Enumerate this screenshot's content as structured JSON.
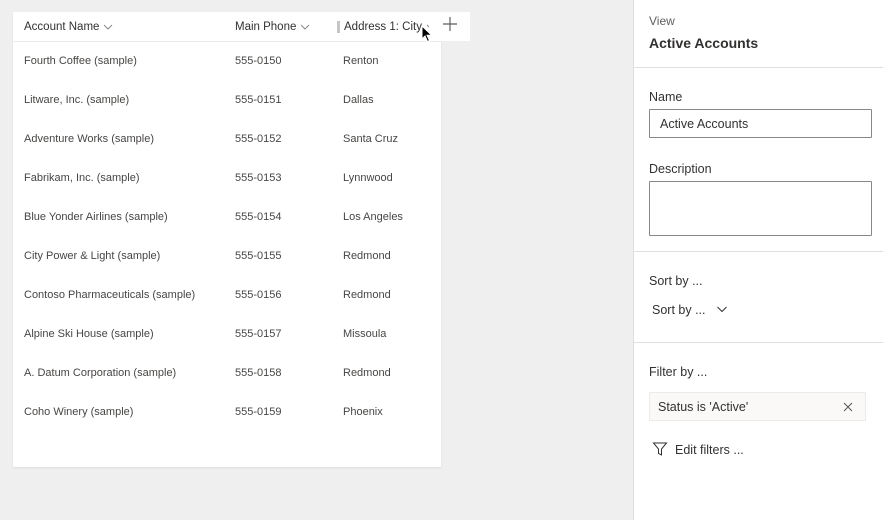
{
  "grid": {
    "columns": {
      "name": "Account Name",
      "phone": "Main Phone",
      "city": "Address 1: City"
    },
    "rows": [
      {
        "name": "Fourth Coffee (sample)",
        "phone": "555-0150",
        "city": "Renton"
      },
      {
        "name": "Litware, Inc. (sample)",
        "phone": "555-0151",
        "city": "Dallas"
      },
      {
        "name": "Adventure Works (sample)",
        "phone": "555-0152",
        "city": "Santa Cruz"
      },
      {
        "name": "Fabrikam, Inc. (sample)",
        "phone": "555-0153",
        "city": "Lynnwood"
      },
      {
        "name": "Blue Yonder Airlines (sample)",
        "phone": "555-0154",
        "city": "Los Angeles"
      },
      {
        "name": "City Power & Light (sample)",
        "phone": "555-0155",
        "city": "Redmond"
      },
      {
        "name": "Contoso Pharmaceuticals (sample)",
        "phone": "555-0156",
        "city": "Redmond"
      },
      {
        "name": "Alpine Ski House (sample)",
        "phone": "555-0157",
        "city": "Missoula"
      },
      {
        "name": "A. Datum Corporation (sample)",
        "phone": "555-0158",
        "city": "Redmond"
      },
      {
        "name": "Coho Winery (sample)",
        "phone": "555-0159",
        "city": "Phoenix"
      }
    ],
    "add_column_icon": "plus-icon"
  },
  "panel": {
    "view_label": "View",
    "view_title": "Active Accounts",
    "name_label": "Name",
    "name_value": "Active Accounts",
    "description_label": "Description",
    "description_value": "",
    "sort_heading": "Sort by ...",
    "sort_dropdown": "Sort by ...",
    "filter_heading": "Filter by ...",
    "filter_chip": "Status is 'Active'",
    "edit_filters": "Edit filters ..."
  }
}
